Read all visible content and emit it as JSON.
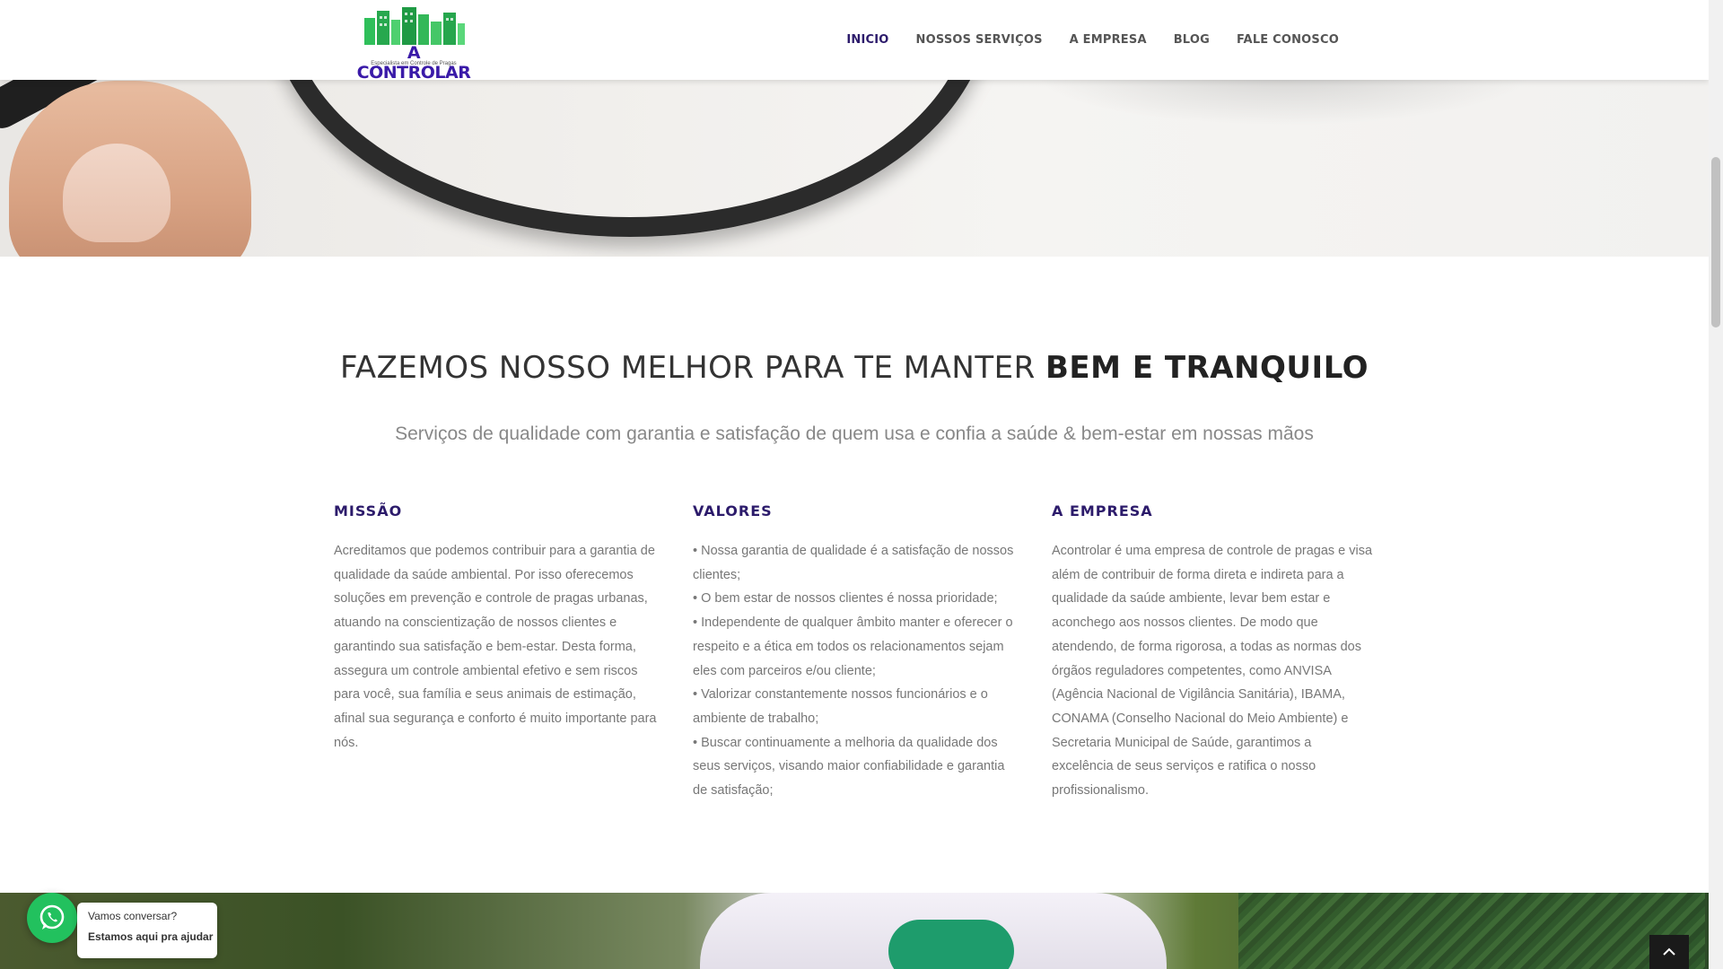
{
  "brand": {
    "name": "A CONTROLAR",
    "tagline": "Especialista em Controle de Pragas"
  },
  "nav": {
    "items": [
      {
        "label": "INICIO",
        "active": true
      },
      {
        "label": "NOSSOS SERVIÇOS",
        "active": false
      },
      {
        "label": "A EMPRESA",
        "active": false
      },
      {
        "label": "BLOG",
        "active": false
      },
      {
        "label": "FALE CONOSCO",
        "active": false
      }
    ]
  },
  "section": {
    "headline_light": "FAZEMOS NOSSO MELHOR PARA TE MANTER",
    "headline_bold": "BEM E TRANQUILO",
    "subtitle": "Serviços de qualidade com garantia e satisfação de quem usa e confia a saúde & bem-estar em nossas mãos"
  },
  "columns": [
    {
      "title": "MISSÃO",
      "text": "Acreditamos que podemos contribuir para a garantia de qualidade da saúde ambiental. Por isso oferecemos soluções em prevenção e controle de pragas urbanas, atuando na conscientização de nossos clientes e garantindo sua satisfação e bem-estar. Desta forma, assegura um controle ambiental efetivo e sem riscos para você, sua família e seus animais de estimação, afinal sua segurança e conforto é muito importante para nós."
    },
    {
      "title": "VALORES",
      "lines": [
        "• Nossa garantia de qualidade é a satisfação de nossos clientes;",
        "• O bem estar de nossos clientes é nossa prioridade;",
        "• Independente de qualquer âmbito manter e oferecer o respeito e a ética  em todos os relacionamentos sejam eles com parceiros e/ou cliente;",
        "• Valorizar constantemente nossos funcionários e o ambiente de trabalho;",
        "• Buscar continuamente a melhoria da qualidade dos seus serviços, visando maior confiabilidade e garantia de satisfação;"
      ]
    },
    {
      "title": "A EMPRESA",
      "text": "Acontrolar é uma empresa de controle de pragas e visa além de contribuir de forma direta e indireta para a qualidade da saúde ambiente, levar bem estar e aconchego aos nossos clientes. De modo que atendendo, de forma rigorosa, a todas as normas dos órgãos reguladores competentes, como ANVISA (Agência Nacional de Vigilância Sanitária), IBAMA, CONAMA (Conselho Nacional do Meio Ambiente) e Secretaria Municipal de Saúde, garantimos a excelência de seus serviços e ratifica o nosso profissionalismo."
    }
  ],
  "whatsapp": {
    "text_regular": "Vamos conversar?",
    "text_bold": "Estamos aqui pra ajudar",
    "color": "#22c15e"
  },
  "icons": {
    "whatsapp": "whatsapp-icon",
    "back_to_top": "chevron-up-icon"
  },
  "colors": {
    "brand_purple": "#2c1b6b",
    "nav_text": "#555555",
    "body_text": "#777777"
  }
}
